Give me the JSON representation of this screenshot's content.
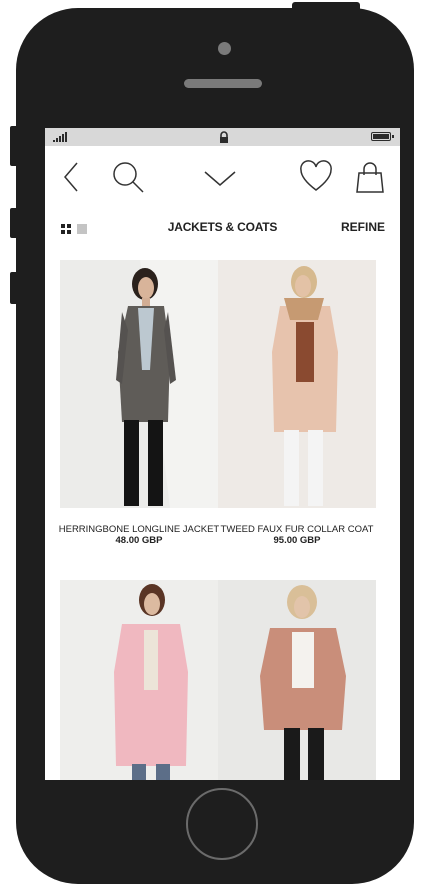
{
  "nav": {
    "back_icon": "back-chevron-icon",
    "search_icon": "search-icon",
    "menu_icon": "chevron-down-icon",
    "wishlist_icon": "heart-icon",
    "bag_icon": "shopping-bag-icon"
  },
  "toolbar": {
    "category_title": "JACKETS & COATS",
    "refine_label": "REFINE",
    "grid_view_icon": "grid-view-icon",
    "list_view_icon": "list-view-icon"
  },
  "products": [
    {
      "name": "HERRINGBONE LONGLINE JACKET",
      "price": "48.00 GBP"
    },
    {
      "name": "TWEED FAUX FUR COLLAR COAT",
      "price": "95.00 GBP"
    },
    {
      "name": "",
      "price": ""
    },
    {
      "name": "",
      "price": ""
    }
  ],
  "colors": {
    "device": "#1e1e1e",
    "status_bar": "#d8d8d8",
    "text": "#222222"
  }
}
